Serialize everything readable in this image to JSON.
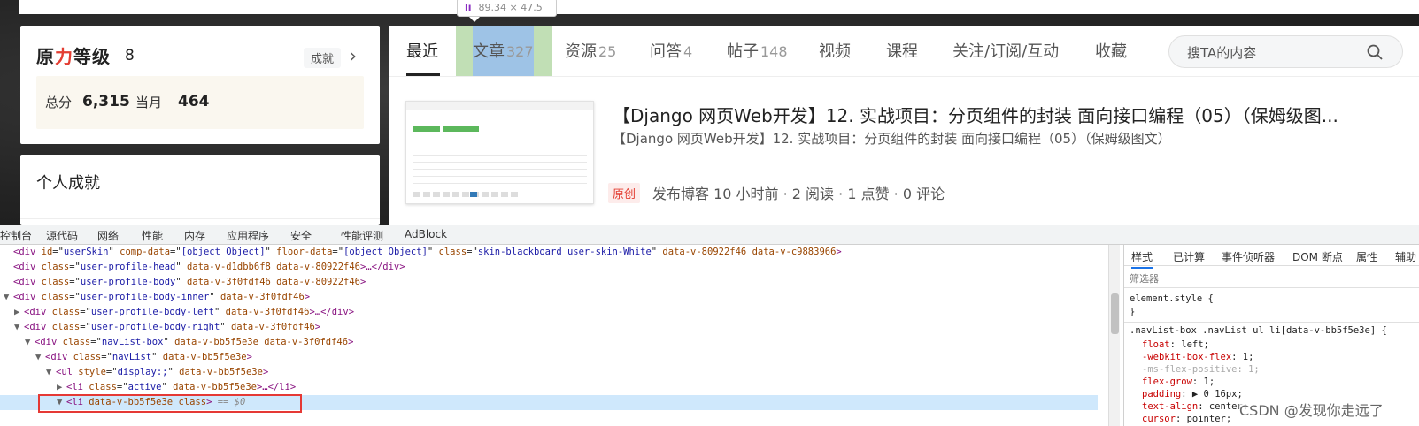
{
  "tooltip": {
    "tag": "li",
    "size": "89.34 × 47.5"
  },
  "level_card": {
    "title_prefix": "原",
    "title_red": "力",
    "title_suffix": "等级",
    "level": "8",
    "achievement_button": "成就",
    "total_label": "总分",
    "total_value": "6,315",
    "month_label": "当月",
    "month_value": "464"
  },
  "achievement_card": {
    "title": "个人成就"
  },
  "nav": {
    "tabs": [
      {
        "label": "最近",
        "count": ""
      },
      {
        "label": "文章",
        "count": "327"
      },
      {
        "label": "资源",
        "count": "25"
      },
      {
        "label": "问答",
        "count": "4"
      },
      {
        "label": "帖子",
        "count": "148"
      },
      {
        "label": "视频",
        "count": ""
      },
      {
        "label": "课程",
        "count": ""
      },
      {
        "label": "关注/订阅/互动",
        "count": ""
      },
      {
        "label": "收藏",
        "count": ""
      }
    ],
    "search_placeholder": "搜TA的内容"
  },
  "article": {
    "title": "【Django 网页Web开发】12. 实战项目：分页组件的封装 面向接口编程（05）（保姆级图...",
    "subtitle": "【Django 网页Web开发】12. 实战项目：分页组件的封装 面向接口编程（05）（保姆级图文）",
    "tag": "原创",
    "meta": "发布博客 10 小时前 · 2 阅读 · 1 点赞 · 0 评论"
  },
  "devtools": {
    "tabs": [
      "控制台",
      "源代码",
      "网络",
      "性能",
      "内存",
      "应用程序",
      "安全",
      "性能评测",
      "AdBlock"
    ],
    "dom_lines": [
      {
        "indent": 0,
        "tri": "",
        "tag": "div",
        "attrs": [
          [
            "id",
            "userSkin"
          ],
          [
            "comp-data",
            "[object Object]"
          ],
          [
            "floor-data",
            "[object Object]"
          ],
          [
            "class",
            "skin-blackboard user-skin-White"
          ],
          [
            "data-v-80922f46",
            ""
          ],
          [
            "data-v-c9883966",
            ""
          ]
        ],
        "tail": ">"
      },
      {
        "indent": 0,
        "tri": "",
        "tag": "div",
        "attrs": [
          [
            "class",
            "user-profile-head"
          ],
          [
            "data-v-d1dbb6f8",
            ""
          ],
          [
            "data-v-80922f46",
            ""
          ]
        ],
        "tail": ">…</div>"
      },
      {
        "indent": 0,
        "tri": "",
        "tag": "div",
        "attrs": [
          [
            "class",
            "user-profile-body"
          ],
          [
            "data-v-3f0fdf46",
            ""
          ],
          [
            "data-v-80922f46",
            ""
          ]
        ],
        "tail": ">"
      },
      {
        "indent": 0,
        "tri": "▼",
        "tag": "div",
        "attrs": [
          [
            "class",
            "user-profile-body-inner"
          ],
          [
            "data-v-3f0fdf46",
            ""
          ]
        ],
        "tail": ">"
      },
      {
        "indent": 1,
        "tri": "▶",
        "tag": "div",
        "attrs": [
          [
            "class",
            "user-profile-body-left"
          ],
          [
            "data-v-3f0fdf46",
            ""
          ]
        ],
        "tail": ">…</div>"
      },
      {
        "indent": 1,
        "tri": "▼",
        "tag": "div",
        "attrs": [
          [
            "class",
            "user-profile-body-right"
          ],
          [
            "data-v-3f0fdf46",
            ""
          ]
        ],
        "tail": ">"
      },
      {
        "indent": 2,
        "tri": "▼",
        "tag": "div",
        "attrs": [
          [
            "class",
            "navList-box"
          ],
          [
            "data-v-bb5f5e3e",
            ""
          ],
          [
            "data-v-3f0fdf46",
            ""
          ]
        ],
        "tail": ">"
      },
      {
        "indent": 3,
        "tri": "▼",
        "tag": "div",
        "attrs": [
          [
            "class",
            "navList"
          ],
          [
            "data-v-bb5f5e3e",
            ""
          ]
        ],
        "tail": ">"
      },
      {
        "indent": 4,
        "tri": "▼",
        "tag": "ul",
        "attrs": [
          [
            "style",
            "display:;"
          ],
          [
            "data-v-bb5f5e3e",
            ""
          ]
        ],
        "tail": ">"
      },
      {
        "indent": 5,
        "tri": "▶",
        "tag": "li",
        "attrs": [
          [
            "class",
            "active"
          ],
          [
            "data-v-bb5f5e3e",
            ""
          ]
        ],
        "tail": ">…</li>"
      },
      {
        "indent": 5,
        "tri": "▼",
        "tag": "li",
        "attrs": [
          [
            "data-v-bb5f5e3e",
            ""
          ],
          [
            "class",
            ""
          ]
        ],
        "tail": "> == $0"
      }
    ],
    "style_tabs": [
      "样式",
      "已计算",
      "事件侦听器",
      "DOM 断点",
      "属性",
      "辅助"
    ],
    "filter_label": "筛选器",
    "element_style": "element.style {",
    "element_style_close": "}",
    "selector": ".navList-box .navList ul li[data-v-bb5f5e3e] {",
    "props": [
      {
        "name": "float",
        "value": "left;",
        "struck": false
      },
      {
        "name": "-webkit-box-flex",
        "value": "1;",
        "struck": false
      },
      {
        "name": "-ms-flex-positive",
        "value": "1;",
        "struck": true
      },
      {
        "name": "flex-grow",
        "value": "1;",
        "struck": false
      },
      {
        "name": "padding",
        "value": "▶ 0 16px;",
        "struck": false
      },
      {
        "name": "text-align",
        "value": "center;",
        "struck": false
      },
      {
        "name": "cursor",
        "value": "pointer;",
        "struck": false
      }
    ]
  },
  "watermark": "CSDN @发现你走远了"
}
